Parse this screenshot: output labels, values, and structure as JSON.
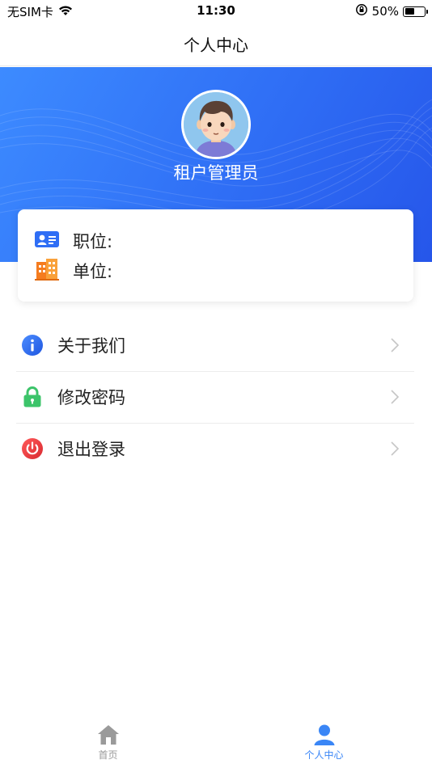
{
  "status_bar": {
    "carrier": "无SIM卡",
    "time": "11:30",
    "battery_percent": "50%",
    "battery_level": 0.5
  },
  "nav": {
    "title": "个人中心"
  },
  "profile": {
    "name": "租户管理员"
  },
  "info": {
    "position_label": "职位:",
    "unit_label": "单位:"
  },
  "menu": [
    {
      "label": "关于我们",
      "icon": "info-icon",
      "color": "#2a6ef0"
    },
    {
      "label": "修改密码",
      "icon": "lock-icon",
      "color": "#3cc46a"
    },
    {
      "label": "退出登录",
      "icon": "power-icon",
      "color": "#e8383d"
    }
  ],
  "tabs": [
    {
      "label": "首页",
      "icon": "home-icon",
      "active": false
    },
    {
      "label": "个人中心",
      "icon": "person-icon",
      "active": true
    }
  ],
  "colors": {
    "accent": "#2f6ef5",
    "tab_inactive": "#9a9a9a",
    "tab_active": "#3a86f6"
  }
}
